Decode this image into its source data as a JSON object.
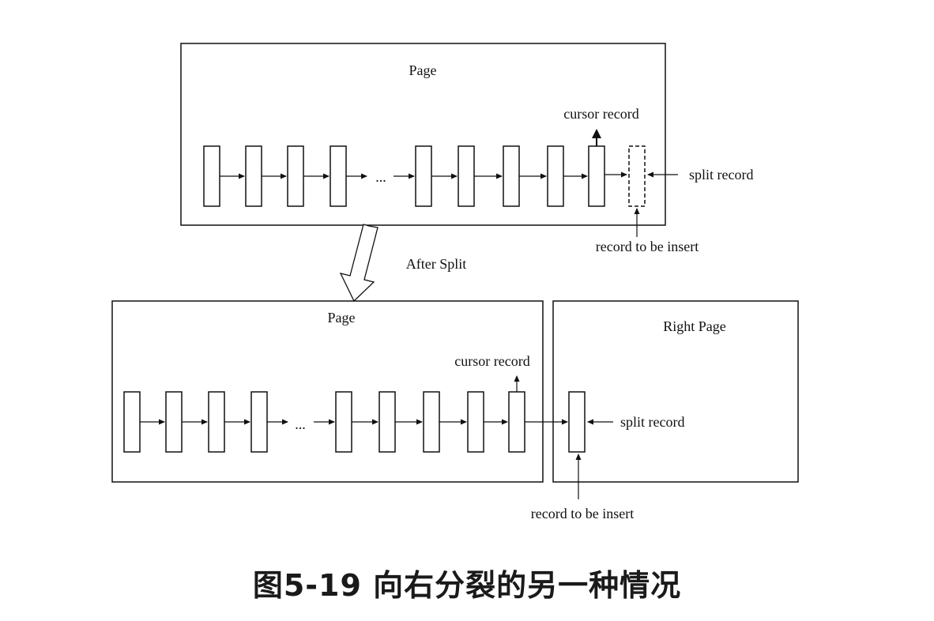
{
  "top_page": {
    "title": "Page",
    "cursor_label": "cursor record",
    "split_label": "split record",
    "insert_label": "record to be insert",
    "ellipsis": "..."
  },
  "transition_label": "After Split",
  "bottom_left_page": {
    "title": "Page",
    "cursor_label": "cursor record",
    "ellipsis": "..."
  },
  "right_page": {
    "title": "Right Page",
    "split_label": "split record",
    "insert_label": "record to be insert"
  },
  "caption": "图5-19 向右分裂的另一种情况"
}
